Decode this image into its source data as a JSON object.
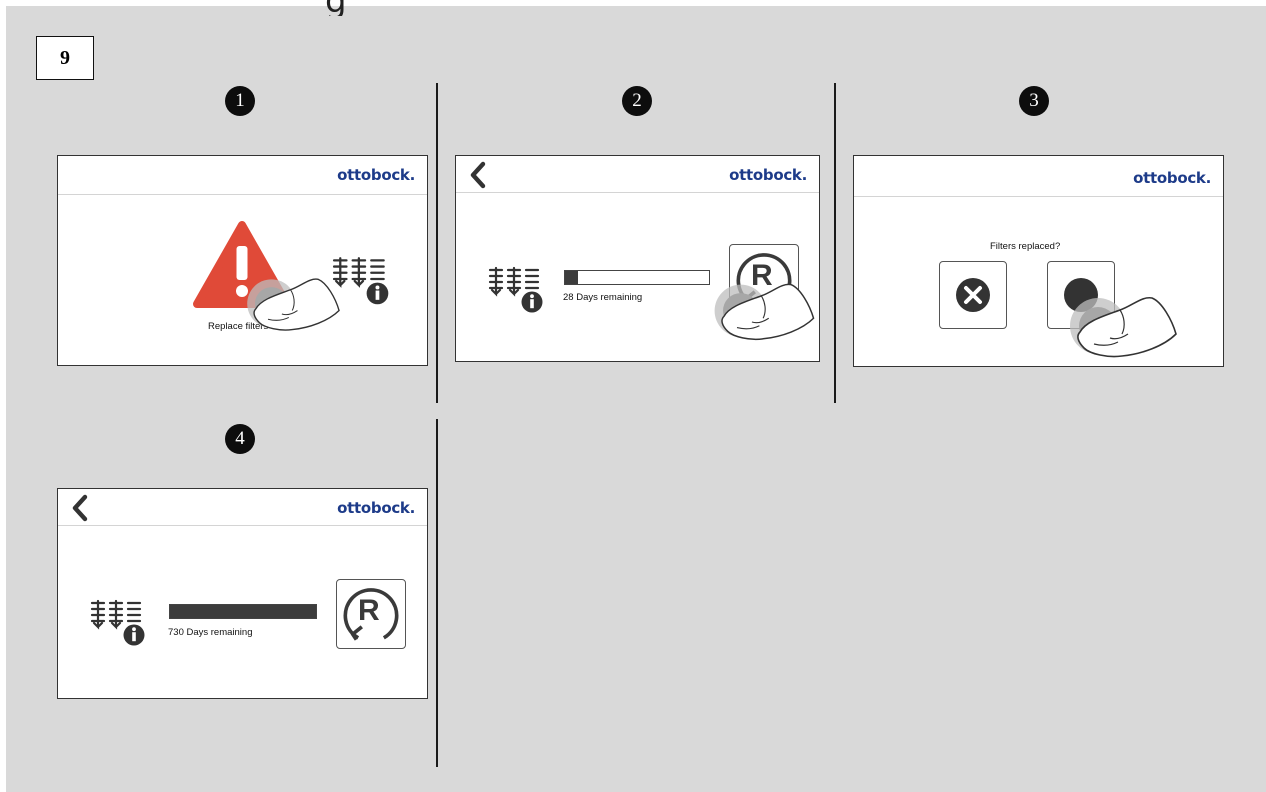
{
  "figure": {
    "number": "9",
    "heading_fragment": "g"
  },
  "brand": "ottobock.",
  "steps": [
    "1",
    "2",
    "3",
    "4"
  ],
  "panel1": {
    "message": "Replace filters"
  },
  "panel2": {
    "days_label": "28 Days remaining",
    "filter_life_fraction": 0.09,
    "reset_letter": "R"
  },
  "panel3": {
    "question": "Filters replaced?"
  },
  "panel4": {
    "days_label": "730 Days remaining",
    "filter_life_fraction": 1.0,
    "reset_letter": "R"
  },
  "icons": {
    "warning": "warning-triangle-icon",
    "filter_info": "filter-info-icon",
    "back": "chevron-left-icon",
    "reset": "reset-r-icon",
    "cancel": "x-circle-icon",
    "finger": "finger-tap-icon"
  },
  "colors": {
    "brand": "#1d3b89",
    "warning": "#e04a38",
    "background": "#d9d9d9"
  }
}
